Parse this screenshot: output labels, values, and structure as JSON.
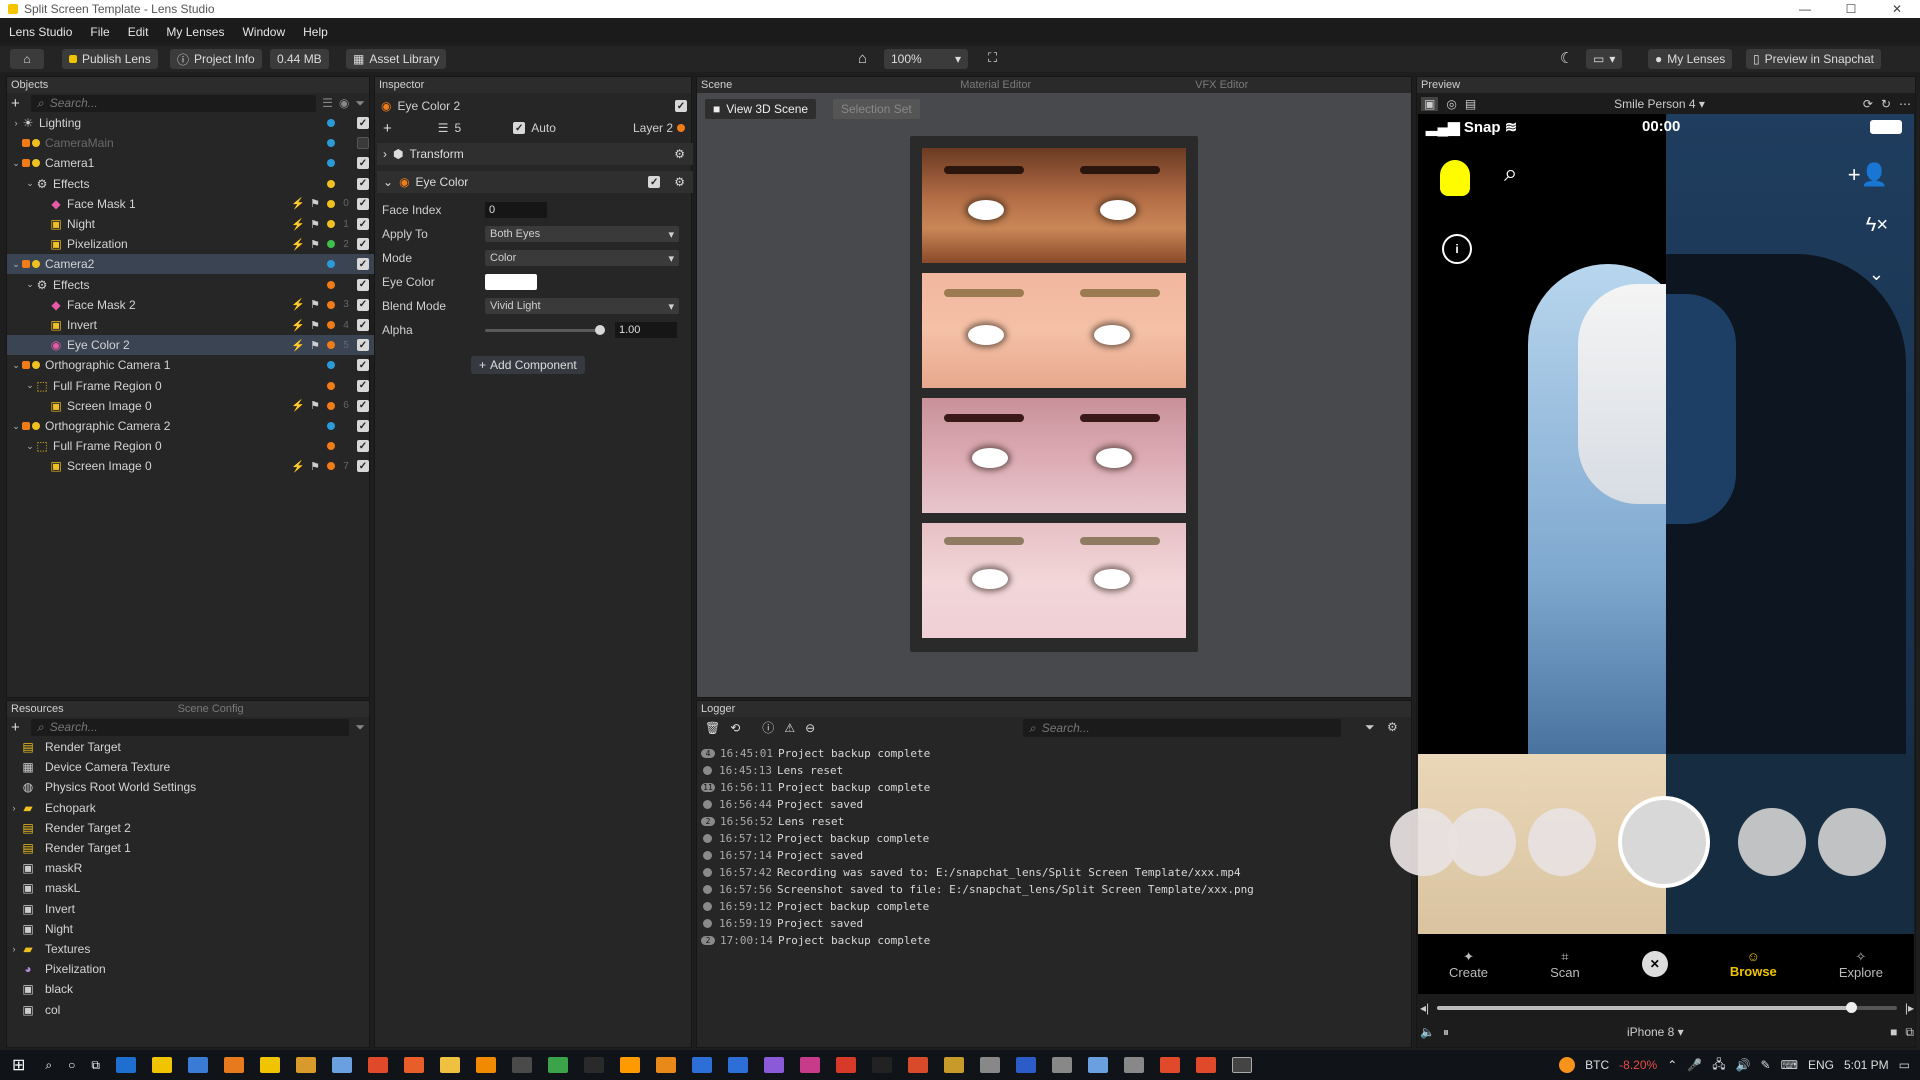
{
  "titlebar": {
    "title": "Split Screen Template - Lens Studio"
  },
  "menu": [
    "Lens Studio",
    "File",
    "Edit",
    "My Lenses",
    "Window",
    "Help"
  ],
  "toolbar": {
    "publish": "Publish Lens",
    "project_info": "Project Info",
    "size": "0.44 MB",
    "asset_library": "Asset Library",
    "zoom": "100%",
    "my_lenses": "My Lenses",
    "preview_snapchat": "Preview in Snapchat"
  },
  "objects": {
    "title": "Objects",
    "search_placeholder": "Search...",
    "rows": [
      {
        "label": "Lighting",
        "indent": 0,
        "arrow": "›",
        "icon": "light-icon",
        "dot": "#2b9bd8",
        "check": true
      },
      {
        "label": "CameraMain",
        "indent": 0,
        "arrow": "",
        "icon": "camera-icon",
        "dot": "#2b9bd8",
        "check": false,
        "dim": true
      },
      {
        "label": "Camera1",
        "indent": 0,
        "arrow": "⌄",
        "icon": "camera-icon",
        "dot": "#2b9bd8",
        "check": true
      },
      {
        "label": "Effects",
        "indent": 1,
        "arrow": "⌄",
        "icon": "effects-icon",
        "dot": "#f0c020",
        "check": true
      },
      {
        "label": "Face Mask 1",
        "indent": 2,
        "arrow": "",
        "icon": "facemask-icon",
        "dot": "#f0c020",
        "check": true,
        "idx": "0",
        "tools": true
      },
      {
        "label": "Night",
        "indent": 2,
        "arrow": "",
        "icon": "image-icon",
        "dot": "#f0c020",
        "check": true,
        "idx": "1",
        "tools": true
      },
      {
        "label": "Pixelization",
        "indent": 2,
        "arrow": "",
        "icon": "image-icon",
        "dot": "#3dbf4a",
        "check": true,
        "idx": "2",
        "tools": true
      },
      {
        "label": "Camera2",
        "indent": 0,
        "arrow": "⌄",
        "icon": "camera-icon",
        "dot": "#2b9bd8",
        "check": true,
        "sel": true
      },
      {
        "label": "Effects",
        "indent": 1,
        "arrow": "⌄",
        "icon": "effects-icon",
        "dot": "#f07c18",
        "check": true
      },
      {
        "label": "Face Mask 2",
        "indent": 2,
        "arrow": "",
        "icon": "facemask-icon",
        "dot": "#f07c18",
        "check": true,
        "idx": "3",
        "tools": true
      },
      {
        "label": "Invert",
        "indent": 2,
        "arrow": "",
        "icon": "image-icon",
        "dot": "#f07c18",
        "check": true,
        "idx": "4",
        "tools": true
      },
      {
        "label": "Eye Color 2",
        "indent": 2,
        "arrow": "",
        "icon": "eyecolor-icon",
        "dot": "#f07c18",
        "check": true,
        "idx": "5",
        "tools": true,
        "sel": true
      },
      {
        "label": "Orthographic Camera 1",
        "indent": 0,
        "arrow": "⌄",
        "icon": "camera-icon",
        "dot": "#2b9bd8",
        "check": true
      },
      {
        "label": "Full Frame Region 0",
        "indent": 1,
        "arrow": "⌄",
        "icon": "frame-icon",
        "dot": "#f07c18",
        "check": true
      },
      {
        "label": "Screen Image 0",
        "indent": 2,
        "arrow": "",
        "icon": "image-icon",
        "dot": "#f07c18",
        "check": true,
        "idx": "6",
        "tools": true
      },
      {
        "label": "Orthographic Camera 2",
        "indent": 0,
        "arrow": "⌄",
        "icon": "camera-icon",
        "dot": "#2b9bd8",
        "check": true
      },
      {
        "label": "Full Frame Region 0",
        "indent": 1,
        "arrow": "⌄",
        "icon": "frame-icon",
        "dot": "#f07c18",
        "check": true
      },
      {
        "label": "Screen Image 0",
        "indent": 2,
        "arrow": "",
        "icon": "image-icon",
        "dot": "#f07c18",
        "check": true,
        "idx": "7",
        "tools": true
      }
    ]
  },
  "resources": {
    "tab": "Resources",
    "tab2": "Scene Config",
    "search_placeholder": "Search...",
    "items": [
      {
        "label": "Render Target",
        "arrow": "",
        "icon": "rendertarget-icon"
      },
      {
        "label": "Device Camera Texture",
        "arrow": "",
        "icon": "texture-icon"
      },
      {
        "label": "Physics Root World Settings",
        "arrow": "",
        "icon": "physics-icon"
      },
      {
        "label": "Echopark",
        "arrow": "›",
        "icon": "folder-icon"
      },
      {
        "label": "Render Target 2",
        "arrow": "",
        "icon": "rendertarget-icon"
      },
      {
        "label": "Render Target 1",
        "arrow": "",
        "icon": "rendertarget-icon"
      },
      {
        "label": "maskR",
        "arrow": "",
        "icon": "image-icon"
      },
      {
        "label": "maskL",
        "arrow": "",
        "icon": "image-icon"
      },
      {
        "label": "Invert",
        "arrow": "",
        "icon": "image-icon"
      },
      {
        "label": "Night",
        "arrow": "",
        "icon": "image-icon"
      },
      {
        "label": "Textures",
        "arrow": "›",
        "icon": "folder-icon"
      },
      {
        "label": "Pixelization",
        "arrow": "",
        "icon": "material-icon"
      },
      {
        "label": "black",
        "arrow": "",
        "icon": "image-icon"
      },
      {
        "label": "col",
        "arrow": "",
        "icon": "image-icon"
      }
    ]
  },
  "inspector": {
    "title": "Inspector",
    "object_name": "Eye Color 2",
    "layer_count": "5",
    "auto_label": "Auto",
    "layer_label": "Layer 2",
    "transform": "Transform",
    "component": "Eye Color",
    "fields": {
      "face_index_label": "Face Index",
      "face_index": "0",
      "apply_to_label": "Apply To",
      "apply_to": "Both Eyes",
      "mode_label": "Mode",
      "mode": "Color",
      "eye_color_label": "Eye Color",
      "eye_color": "#ffffff",
      "blend_label": "Blend Mode",
      "blend": "Vivid Light",
      "alpha_label": "Alpha",
      "alpha": "1.00"
    },
    "add_component": "Add Component"
  },
  "scene": {
    "tabs": [
      "Scene",
      "Material Editor",
      "VFX Editor"
    ],
    "view3d": "View 3D Scene",
    "selection_set": "Selection Set"
  },
  "logger": {
    "title": "Logger",
    "search_placeholder": "Search...",
    "rows": [
      {
        "time": "16:45:01",
        "msg": "Project backup complete",
        "lvl": "4"
      },
      {
        "time": "16:45:13",
        "msg": "Lens reset",
        "lvl": ""
      },
      {
        "time": "16:56:11",
        "msg": "Project backup complete",
        "lvl": "11"
      },
      {
        "time": "16:56:44",
        "msg": "Project saved",
        "lvl": ""
      },
      {
        "time": "16:56:52",
        "msg": "Lens reset",
        "lvl": "2"
      },
      {
        "time": "16:57:12",
        "msg": "Project backup complete",
        "lvl": ""
      },
      {
        "time": "16:57:14",
        "msg": "Project saved",
        "lvl": ""
      },
      {
        "time": "16:57:42",
        "msg": "Recording was saved to:  E:/snapchat_lens/Split Screen Template/xxx.mp4",
        "lvl": ""
      },
      {
        "time": "16:57:56",
        "msg": "Screenshot saved to file: E:/snapchat_lens/Split Screen Template/xxx.png",
        "lvl": ""
      },
      {
        "time": "16:59:12",
        "msg": "Project backup complete",
        "lvl": ""
      },
      {
        "time": "16:59:19",
        "msg": "Project saved",
        "lvl": ""
      },
      {
        "time": "17:00:14",
        "msg": "Project backup complete",
        "lvl": "2"
      }
    ]
  },
  "preview": {
    "title": "Preview",
    "person": "Smile Person 4",
    "carrier": "Snap",
    "timer": "00:00",
    "nav": [
      "Create",
      "Scan",
      "Browse",
      "Explore"
    ],
    "device": "iPhone 8",
    "progress": 0.9
  },
  "taskbar": {
    "btc_label": "BTC",
    "btc_change": "-8.20%",
    "lang": "ENG",
    "time": "5:01 PM"
  },
  "colors": {
    "accent": "#2b9bd8",
    "orange": "#f07c18",
    "yellow": "#f0c020",
    "green": "#3dbf4a",
    "snap_yellow": "#fffc00",
    "browse": "#f0c400"
  }
}
